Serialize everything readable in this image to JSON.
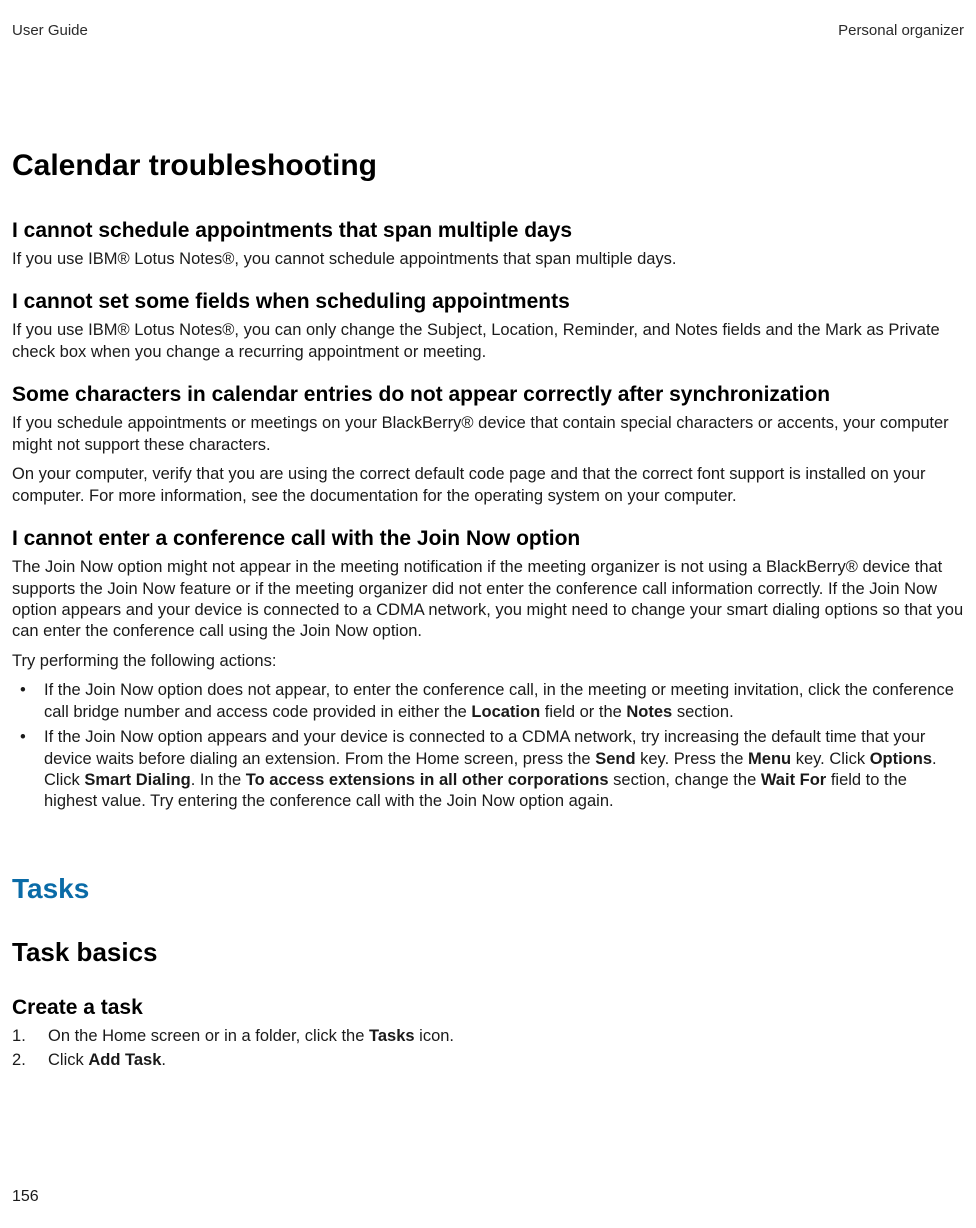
{
  "header": {
    "left": "User Guide",
    "right": "Personal organizer"
  },
  "h1": "Calendar troubleshooting",
  "sec1": {
    "title": "I cannot schedule appointments that span multiple days",
    "p1": "If you use IBM® Lotus Notes®, you cannot schedule appointments that span multiple days."
  },
  "sec2": {
    "title": "I cannot set some fields when scheduling appointments",
    "p1": "If you use IBM® Lotus Notes®, you can only change the Subject, Location, Reminder, and Notes fields and the Mark as Private check box when you change a recurring appointment or meeting."
  },
  "sec3": {
    "title": "Some characters in calendar entries do not appear correctly after synchronization",
    "p1": "If you schedule appointments or meetings on your BlackBerry® device that contain special characters or accents, your computer might not support these characters.",
    "p2": "On your computer, verify that you are using the correct default code page and that the correct font support is installed on your computer. For more information, see the documentation for the operating system on your computer."
  },
  "sec4": {
    "title": "I cannot enter a conference call with the Join Now option",
    "p1": "The Join Now option might not appear in the meeting notification if the meeting organizer is not using a BlackBerry® device that supports the Join Now feature or if the meeting organizer did not enter the conference call information correctly. If the Join Now option appears and your device is connected to a CDMA network, you might need to change your smart dialing options so that you can enter the conference call using the Join Now option.",
    "p2": "Try performing the following actions:",
    "b1a": "If the Join Now option does not appear, to enter the conference call, in the meeting or meeting invitation, click the conference call bridge number and access code provided in either the ",
    "b1b": "Location",
    "b1c": " field or the ",
    "b1d": "Notes",
    "b1e": " section.",
    "b2a": "If the Join Now option appears and your device is connected to a CDMA network, try increasing the default time that your device waits before dialing an extension. From the Home screen, press the ",
    "b2b": "Send",
    "b2c": " key. Press the ",
    "b2d": "Menu",
    "b2e": " key. Click ",
    "b2f": "Options",
    "b2g": ". Click ",
    "b2h": "Smart Dialing",
    "b2i": ". In the ",
    "b2j": "To access extensions in all other corporations",
    "b2k": " section, change the ",
    "b2l": "Wait For",
    "b2m": " field to the highest value. Try entering the conference call with the Join Now option again."
  },
  "tasks": {
    "title": "Tasks",
    "basics": "Task basics",
    "createTitle": "Create a task",
    "s1a": "On the Home screen or in a folder, click the ",
    "s1b": "Tasks",
    "s1c": " icon.",
    "s2a": "Click ",
    "s2b": "Add Task",
    "s2c": "."
  },
  "page": "156"
}
